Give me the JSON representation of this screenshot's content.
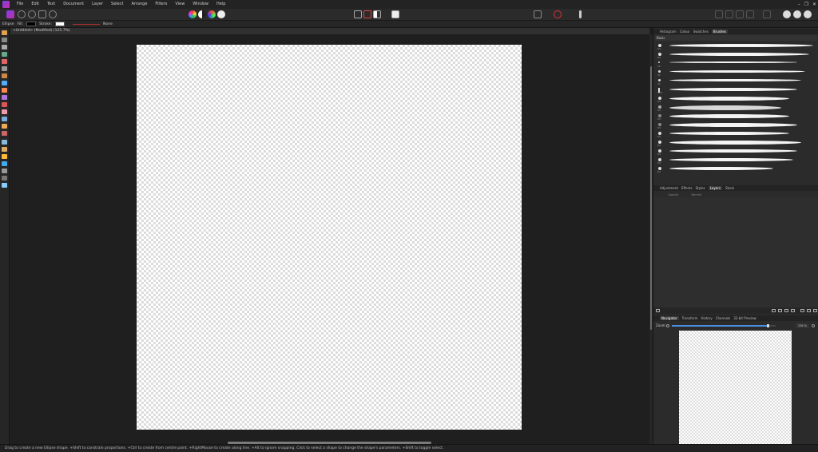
{
  "menu": [
    "File",
    "Edit",
    "Text",
    "Document",
    "Layer",
    "Select",
    "Arrange",
    "Filters",
    "View",
    "Window",
    "Help"
  ],
  "window_controls": {
    "minimize": "–",
    "restore": "❐",
    "close": "✕"
  },
  "context": {
    "tool": "Ellipse",
    "fill_label": "Fill:",
    "stroke_label": "Stroke:",
    "stroke_style": "None",
    "fill_color": "#000000",
    "stroke_color": "#ffffff"
  },
  "document": {
    "tab_title": "<Untitled> (Modified) (125.7%)"
  },
  "brushes": {
    "tabs": [
      "Histogram",
      "Colour",
      "Swatches",
      "Brushes"
    ],
    "category": "Basic",
    "items": [
      {
        "size": "64"
      },
      {
        "size": "64"
      },
      {
        "size": "16"
      },
      {
        "size": "32"
      },
      {
        "size": "32"
      },
      {
        "size": "128"
      },
      {
        "size": "64"
      },
      {
        "size": "64"
      },
      {
        "size": "64"
      },
      {
        "size": "64"
      },
      {
        "size": "64"
      },
      {
        "size": "64"
      },
      {
        "size": "64"
      },
      {
        "size": "64"
      },
      {
        "size": "64"
      }
    ]
  },
  "layers": {
    "tabs": [
      "Adjustment",
      "Effects",
      "Styles",
      "Layers",
      "Stock"
    ],
    "opacity_label": "Opacity",
    "blend_mode": "Normal"
  },
  "navigator": {
    "tabs": [
      "Navigator",
      "Transform",
      "History",
      "Channels",
      "32-bit Preview"
    ],
    "zoom_label": "Zoom:",
    "zoom_value": "236 %",
    "zoom_level": 0.92
  },
  "status": "Drag to create a new Ellipse shape. +Shift to constrain proportions. +Ctrl to create from centre point. +RightMouse to create along line. +Alt to ignore snapping. Click to select a shape to change the shape's parameters. +Shift to toggle select.",
  "colors": {
    "accent": "#4a8fe0",
    "logo_a": "#7b3fe4",
    "logo_b": "#c42fa8"
  }
}
